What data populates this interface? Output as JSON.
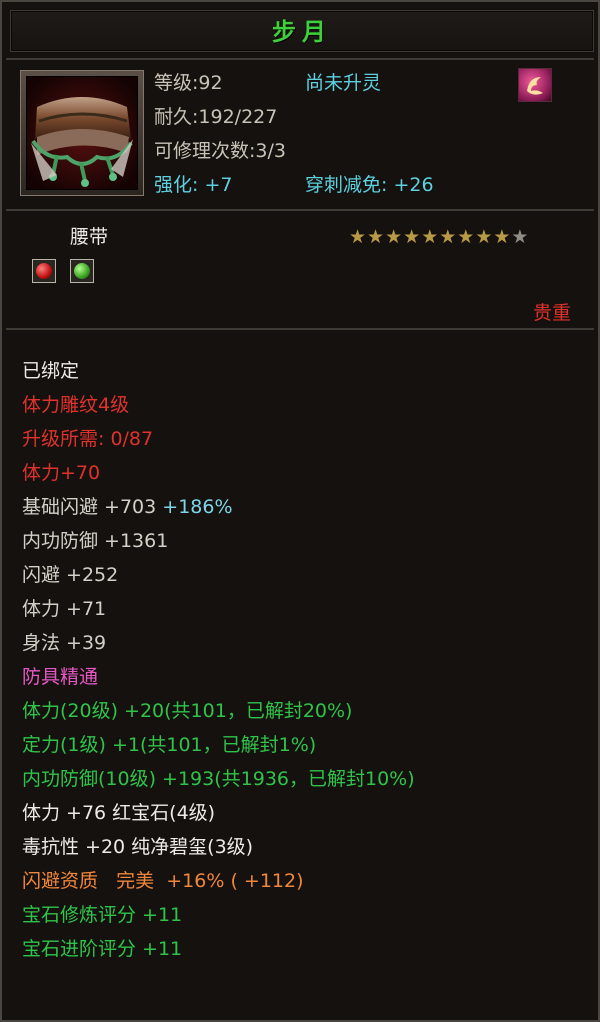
{
  "item": {
    "name": "步月",
    "level_text": "等级:92",
    "soul_status": "尚未升灵",
    "durability_text": "耐久:192/227",
    "repair_text": "可修理次数:3/3",
    "enhance_text": "强化: +7",
    "pierce_text": "穿刺减免: +26",
    "type": "腰带",
    "stars_filled": 9,
    "stars_total": 10,
    "rarity": "贵重",
    "gem_slots": [
      "red-gem",
      "green-gem"
    ]
  },
  "props": {
    "bound": "已绑定",
    "carving": "体力雕纹4级",
    "upgrade_req": "升级所需: 0/87",
    "carving_bonus": "体力+70",
    "base_dodge": "基础闪避 +703",
    "base_dodge_pct": "+186%",
    "inner_def": "内功防御 +1361",
    "dodge": "闪避 +252",
    "stamina": "体力 +71",
    "agility": "身法 +39",
    "mastery_title": "防具精通",
    "mastery_1": "体力(20级) +20(共101，已解封20%)",
    "mastery_2": "定力(1级) +1(共101，已解封1%)",
    "mastery_3": "内功防御(10级) +193(共1936，已解封10%)",
    "gem_1": "体力 +76 红宝石(4级)",
    "gem_2": "毒抗性 +20 纯净碧玺(3级)",
    "aptitude_label": "闪避资质",
    "aptitude_grade": "完美",
    "aptitude_value": "+16%",
    "aptitude_bonus": "( +112)",
    "gem_refine": "宝石修炼评分 +11",
    "gem_advance": "宝石进阶评分 +11"
  },
  "colors": {
    "title": "#3fcf3a",
    "red": "#e0322c",
    "green": "#2fc449",
    "cyan": "#5fd0e0",
    "pink": "#e657c4",
    "orange": "#f0873a"
  }
}
